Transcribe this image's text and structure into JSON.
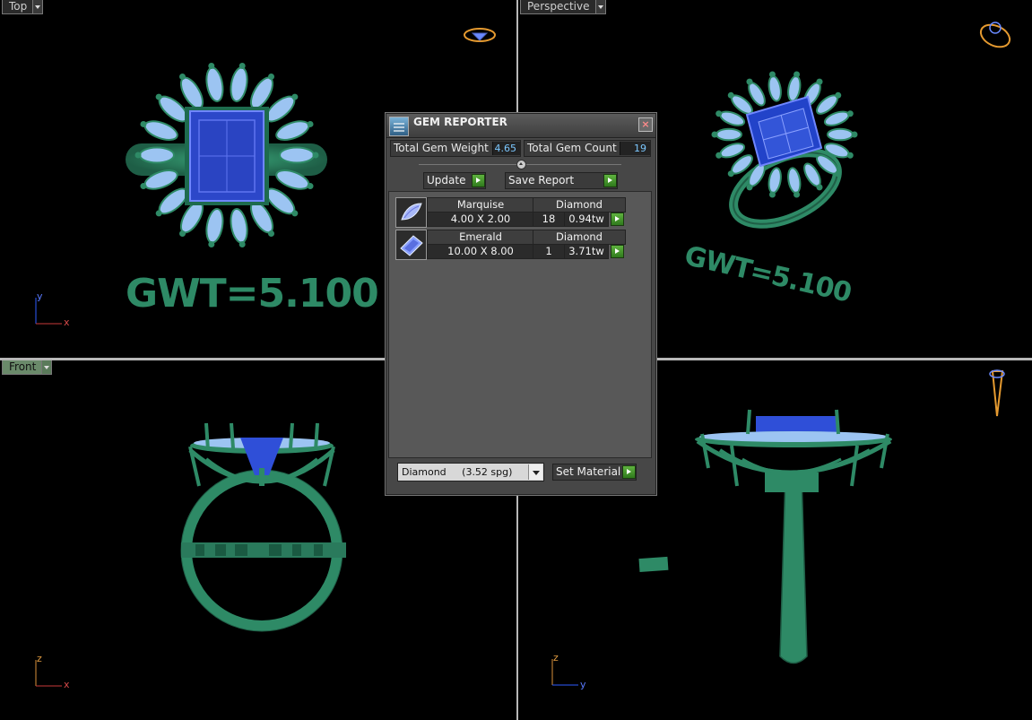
{
  "viewports": {
    "top": {
      "label": "Top",
      "text": "GWT=5.100",
      "axis1": "y",
      "axis2": "x"
    },
    "perspective": {
      "label": "Perspective",
      "text": "GWT=5.100"
    },
    "front": {
      "label": "Front",
      "axis1": "z",
      "axis2": "x"
    },
    "right": {
      "axis1": "z",
      "axis2": "y"
    }
  },
  "dialog": {
    "title": "GEM REPORTER",
    "close": "×",
    "total_gem_weight_label": "Total Gem Weight",
    "total_gem_weight_value": "4.65",
    "total_gem_count_label": "Total Gem Count",
    "total_gem_count_value": "19",
    "update_label": "Update",
    "save_report_label": "Save Report",
    "gems": [
      {
        "shape": "Marquise",
        "material": "Diamond",
        "size": "4.00 X 2.00",
        "count": "18",
        "weight": "0.94tw"
      },
      {
        "shape": "Emerald",
        "material": "Diamond",
        "size": "10.00 X 8.00",
        "count": "1",
        "weight": "3.71tw"
      }
    ],
    "material_select": "Diamond     (3.52 spg)",
    "set_material_label": "Set Material"
  },
  "colors": {
    "metal": "#2e8a66",
    "main_stone": "#2f4fd8",
    "side_stones": "#9cc4f2",
    "viewport_bg": "#000000"
  }
}
